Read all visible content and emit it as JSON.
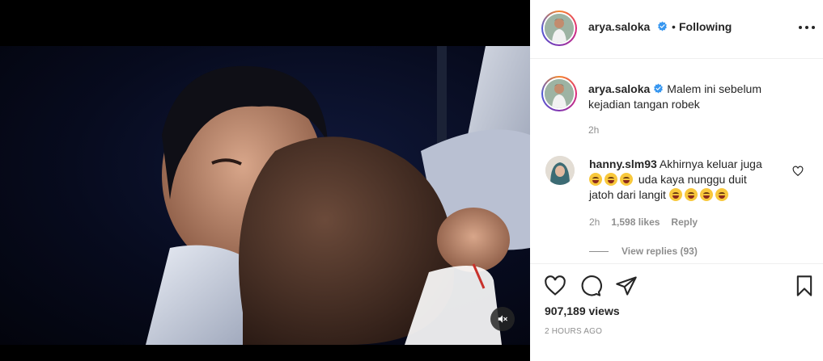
{
  "post": {
    "username": "arya.saloka",
    "follow_separator": "•",
    "follow_status": "Following",
    "caption": "Malem ini sebelum kejadian tangan robek",
    "caption_time": "2h",
    "views": "907,189 views",
    "posted_ago": "2 HOURS AGO"
  },
  "comment": {
    "username": "hanny.slm93",
    "text_line1": "Akhirnya keluar juga",
    "text_line2": "uda kaya nunggu duit",
    "text_line3": "jatoh dari langit",
    "time": "2h",
    "likes": "1,598 likes",
    "reply_label": "Reply",
    "view_replies": "View replies (93)"
  },
  "colors": {
    "verified": "#3897f0",
    "text": "#262626",
    "secondary": "#8e8e8e",
    "divider": "#efefef",
    "video_bg": "#000000"
  },
  "icons": {
    "more": "more-options-icon",
    "like": "heart-icon",
    "comment": "comment-icon",
    "share": "paper-plane-icon",
    "save": "bookmark-icon",
    "mute": "speaker-muted-icon"
  }
}
